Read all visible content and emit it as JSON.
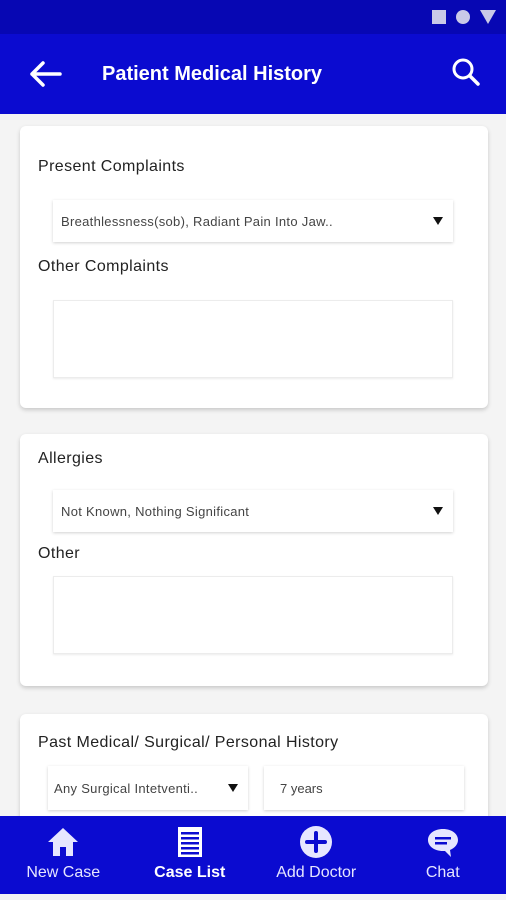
{
  "app_bar": {
    "title": "Patient Medical History"
  },
  "card_complaints": {
    "present_label": "Present Complaints",
    "present_value": "Breathlessness(sob), Radiant Pain Into Jaw..",
    "other_label": "Other Complaints",
    "other_value": ""
  },
  "card_allergies": {
    "allergies_label": "Allergies",
    "allergies_value": "Not Known, Nothing Significant",
    "other_label": "Other",
    "other_value": ""
  },
  "card_history": {
    "history_label": "Past Medical/ Surgical/ Personal History",
    "intervention_value": "Any Surgical Intetventi..",
    "duration_value": "7 years"
  },
  "bottom_nav": {
    "items": [
      {
        "label": "New Case",
        "icon": "home-icon"
      },
      {
        "label": "Case List",
        "icon": "list-icon",
        "active": true
      },
      {
        "label": "Add Doctor",
        "icon": "add-circle-icon"
      },
      {
        "label": "Chat",
        "icon": "chat-icon"
      }
    ]
  },
  "colors": {
    "primary": "#0b0bd0",
    "status_bar": "#0707b3",
    "background": "#f4f4f4"
  }
}
